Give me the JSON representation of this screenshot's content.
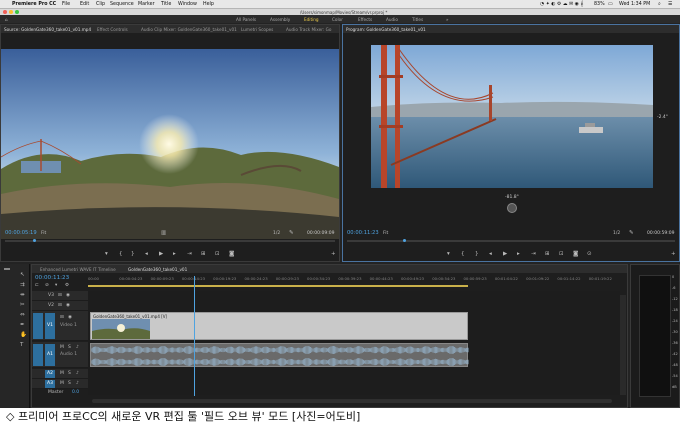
{
  "menubar": {
    "app_name": "Premiere Pro CC",
    "items": [
      "File",
      "Edit",
      "Clip",
      "Sequence",
      "Marker",
      "Title",
      "Window",
      "Help"
    ],
    "battery": "83%",
    "clock": "Wed 1:34 PM"
  },
  "titlebar": {
    "path": "/Users/simonmap/Movies/Stream/vr.prproj *"
  },
  "workspaces": {
    "items": [
      "All Panels",
      "Assembly",
      "Editing",
      "Color",
      "Effects",
      "Audio",
      "Titles"
    ],
    "active": "Editing"
  },
  "source_panel": {
    "tabs": [
      "Source: GoldenGate360_take01_v01.mp4",
      "Effect Controls",
      "Audio Clip Mixer: GoldenGate360_take01_v01",
      "Lumetri Scopes",
      "Audio Track Mixer: Go"
    ],
    "timecode": "00:00:05:19",
    "fit": "Fit",
    "resolution": "1/2",
    "duration": "00:00:09:09"
  },
  "program_panel": {
    "tabs": [
      "Program: GoldenGate360_take01_v01"
    ],
    "timecode": "00:00:11:23",
    "fit": "Fit",
    "resolution": "1/2",
    "duration": "00:00:59:09",
    "angle_right": "-2.4°",
    "angle_bottom": "-81.8°"
  },
  "timeline": {
    "tabs": [
      "Enhanced Lumetri WAVE IT Timeline",
      "GoldenGate360_take01_v01"
    ],
    "timecode": "00:00:11:23",
    "ticks": [
      "00:00",
      "00:00:04:23",
      "00:00:09:23",
      "00:00:14:23",
      "00:00:19:23",
      "00:00:24:23",
      "00:00:29:23",
      "00:00:34:23",
      "00:00:39:23",
      "00:00:44:23",
      "00:00:49:23",
      "00:00:54:23",
      "00:00:59:23",
      "00:01:04:22",
      "00:01:09:22",
      "00:01:14:22",
      "00:01:19:22"
    ],
    "tracks": [
      {
        "id": "V3",
        "name": ""
      },
      {
        "id": "V2",
        "name": ""
      },
      {
        "id": "V1",
        "name": "Video 1"
      },
      {
        "id": "A1",
        "name": "Audio 1"
      },
      {
        "id": "A2",
        "name": ""
      },
      {
        "id": "A3",
        "name": ""
      }
    ],
    "master_label": "Master",
    "master_value": "0.0",
    "video_clip_label": "GoldenGate360_take01_v01.mp4 [V]",
    "playhead_fraction": 0.2
  },
  "caption": "◇ 프리미어 프로CC의 새로운 VR 편집 툴 '필드 오브 뷰' 모드 [사진=어도비]",
  "colors": {
    "accent": "#4fa3e0",
    "workspace_active": "#e8c94a"
  }
}
